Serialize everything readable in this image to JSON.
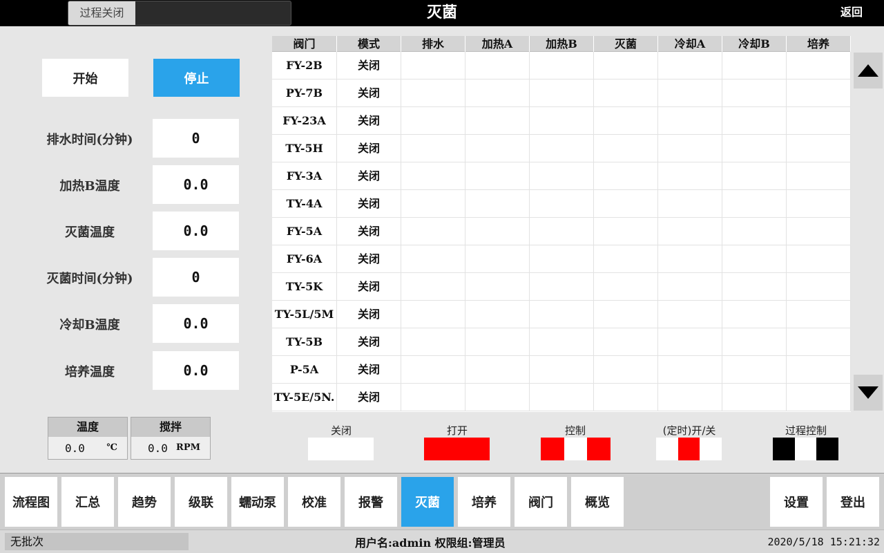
{
  "header": {
    "process_label": "过程关闭",
    "title": "灭菌",
    "back_label": "返回"
  },
  "controls": {
    "start_label": "开始",
    "stop_label": "停止"
  },
  "params": [
    {
      "label": "排水时间(分钟)",
      "value": "0"
    },
    {
      "label": "加热B温度",
      "value": "0.0"
    },
    {
      "label": "灭菌温度",
      "value": "0.0"
    },
    {
      "label": "灭菌时间(分钟)",
      "value": "0"
    },
    {
      "label": "冷却B温度",
      "value": "0.0"
    },
    {
      "label": "培养温度",
      "value": "0.0"
    }
  ],
  "gauges": {
    "temp": {
      "title": "温度",
      "value": "0.0",
      "unit": "℃"
    },
    "stir": {
      "title": "搅拌",
      "value": "0.0",
      "unit": "RPM"
    }
  },
  "table": {
    "headers": [
      "阀门",
      "模式",
      "排水",
      "加热A",
      "加热B",
      "灭菌",
      "冷却A",
      "冷却B",
      "培养"
    ],
    "rows": [
      [
        "FY-2B",
        "关闭"
      ],
      [
        "PY-7B",
        "关闭"
      ],
      [
        "FY-23A",
        "关闭"
      ],
      [
        "TY-5H",
        "关闭"
      ],
      [
        "FY-3A",
        "关闭"
      ],
      [
        "TY-4A",
        "关闭"
      ],
      [
        "FY-5A",
        "关闭"
      ],
      [
        "FY-6A",
        "关闭"
      ],
      [
        "TY-5K",
        "关闭"
      ],
      [
        "TY-5L/5M",
        "关闭"
      ],
      [
        "TY-5B",
        "关闭"
      ],
      [
        "P-5A",
        "关闭"
      ],
      [
        "TY-5E/5N.",
        "关闭"
      ]
    ]
  },
  "legend": [
    {
      "label": "关闭",
      "pattern": [
        "#ffffff"
      ]
    },
    {
      "label": "打开",
      "pattern": [
        "#ff0000"
      ]
    },
    {
      "label": "控制",
      "pattern": [
        "#ff0000",
        "#ffffff",
        "#ff0000"
      ]
    },
    {
      "label": "(定时)开/关",
      "pattern": [
        "#ffffff",
        "#ff0000",
        "#ffffff"
      ]
    },
    {
      "label": "过程控制",
      "pattern": [
        "#000000",
        "#ffffff",
        "#000000"
      ]
    }
  ],
  "nav": {
    "items": [
      "流程图",
      "汇总",
      "趋势",
      "级联",
      "蠕动泵",
      "校准",
      "报警",
      "灭菌",
      "培养",
      "阀门",
      "概览"
    ],
    "active": "灭菌",
    "settings_label": "设置",
    "logout_label": "登出"
  },
  "status": {
    "batch": "无批次",
    "user": "用户名:admin  权限组:管理员",
    "datetime": "2020/5/18 15:21:32"
  },
  "colors": {
    "accent": "#2aa3ea",
    "open": "#ff0000"
  }
}
